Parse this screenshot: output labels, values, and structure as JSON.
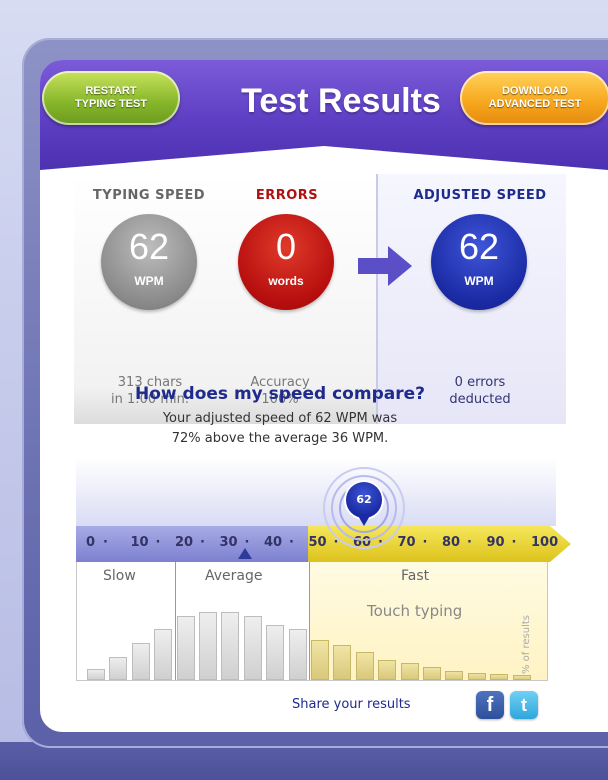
{
  "header": {
    "title": "Test Results",
    "restart_button": "RESTART\nTYPING TEST",
    "download_button": "DOWNLOAD\nADVANCED TEST"
  },
  "stats": {
    "typing": {
      "label": "TYPING SPEED",
      "value": "62",
      "unit": "WPM",
      "sub_line1": "313 chars",
      "sub_line2": "in 1:00 min."
    },
    "errors": {
      "label": "ERRORS",
      "value": "0",
      "unit": "words",
      "sub_line1": "Accuracy",
      "sub_line2": "100%"
    },
    "adjusted": {
      "label": "ADJUSTED SPEED",
      "value": "62",
      "unit": "WPM",
      "sub_line1": "0 errors",
      "sub_line2": "deducted"
    }
  },
  "compare": {
    "title": "How does my speed compare?",
    "line1": "Your adjusted speed of 62 WPM was",
    "line2": "72% above the average 36 WPM."
  },
  "scale": {
    "ticks": [
      "0",
      "10",
      "20",
      "30",
      "40",
      "50",
      "60",
      "70",
      "80",
      "90",
      "100"
    ],
    "marker_value": "62",
    "zones": {
      "slow": "Slow",
      "average": "Average",
      "fast": "Fast",
      "touch": "Touch typing",
      "axis_label": "% of results"
    }
  },
  "distribution": {
    "note": "relative bar heights, left to right",
    "values": [
      0.12,
      0.25,
      0.4,
      0.55,
      0.7,
      0.74,
      0.74,
      0.7,
      0.6,
      0.55,
      0.43,
      0.38,
      0.3,
      0.22,
      0.18,
      0.14,
      0.1,
      0.08,
      0.06,
      0.05
    ]
  },
  "footer": {
    "share_text": "Share your results",
    "facebook_icon": "f",
    "twitter_icon": "t"
  },
  "colors": {
    "header_purple": "#5e3fc4",
    "title_blue": "#1e2a8c",
    "error_red": "#b60e0e",
    "adjusted_blue": "#1a2aa3",
    "fast_yellow": "#dcc21c"
  }
}
